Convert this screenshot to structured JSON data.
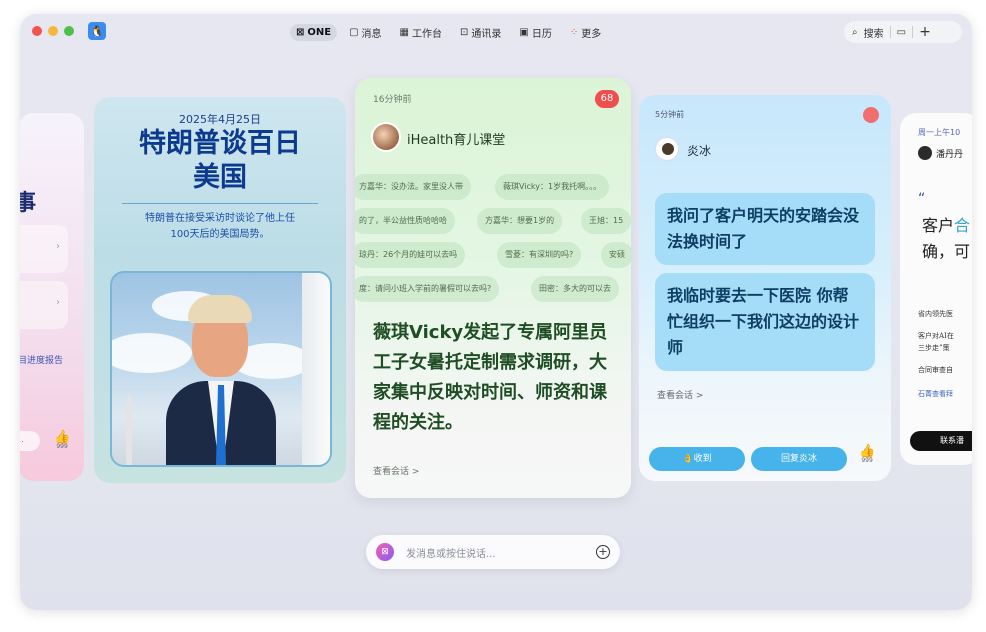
{
  "window": {
    "traffic_lights": [
      "#f2544f",
      "#f6b73b",
      "#4dc04a"
    ],
    "app_icon": "penguin-app-icon"
  },
  "topnav": [
    {
      "label": "ONE",
      "icon": "one-icon",
      "active": true
    },
    {
      "label": "消息",
      "icon": "message-icon",
      "active": false
    },
    {
      "label": "工作台",
      "icon": "workbench-icon",
      "active": false
    },
    {
      "label": "通讯录",
      "icon": "contacts-icon",
      "active": false
    },
    {
      "label": "日历",
      "icon": "calendar-icon",
      "active": false
    },
    {
      "label": "更多",
      "icon": "more-grid-icon",
      "active": false
    }
  ],
  "tools": {
    "search_label": "搜索",
    "chat_icon": "chat-bubble-icon",
    "add_icon": "plus-icon"
  },
  "left_card": {
    "title_fragment": "事",
    "report_fragment": "目进度报告",
    "pill_fragment": "...",
    "like_count": "999"
  },
  "news_card": {
    "date": "2025年4月25日",
    "headline_line1": "特朗普谈百日",
    "headline_line2": "美国",
    "subtitle_line1": "特朗普在接受采访时谈论了他上任",
    "subtitle_line2": "100天后的美国局势。"
  },
  "center_card": {
    "time": "16分钟前",
    "badge": "68",
    "channel": "iHealth育儿课堂",
    "chips": [
      "方嘉华：没办法。家里没人带",
      "薇琪Vicky：1岁我托啊。。。",
      "的了，半公益性质哈哈哈",
      "方嘉华：想要1岁的",
      "王旭：15",
      "琼丹：26个月的娃可以去吗",
      "雪菱：有深圳的吗?",
      "安硕",
      "度：请问小班入学前的暑假可以去吗?",
      "田密：多大的可以去"
    ],
    "body": "薇琪Vicky发起了专属阿里员工子女暑托定制需求调研，大家集中反映对时间、师资和课程的关注。",
    "view_link": "查看会话 >"
  },
  "right_card": {
    "time": "5分钟前",
    "name": "炎冰",
    "bubble1": "我问了客户明天的安踏会没法换时间了",
    "bubble2": "我临时要去一下医院 你帮忙组织一下我们这边的设计师",
    "view_link": "查看会话 >",
    "btn_received": "👌收到",
    "btn_reply": "回复炎冰",
    "like_count": "999"
  },
  "far_card": {
    "time": "周一上午10",
    "name": "潘丹丹",
    "quote_mark": "“",
    "big_line1_a": "客户",
    "big_line1_b": "合",
    "big_line2": "确，可",
    "lines": [
      "省内领先医",
      "客户对AI在",
      "三步走”策",
      "合同审查自",
      "石菁查看拜"
    ],
    "button": "联系潘"
  },
  "composer": {
    "placeholder": "发消息或按住说话...",
    "add_icon": "plus-circle-icon"
  }
}
